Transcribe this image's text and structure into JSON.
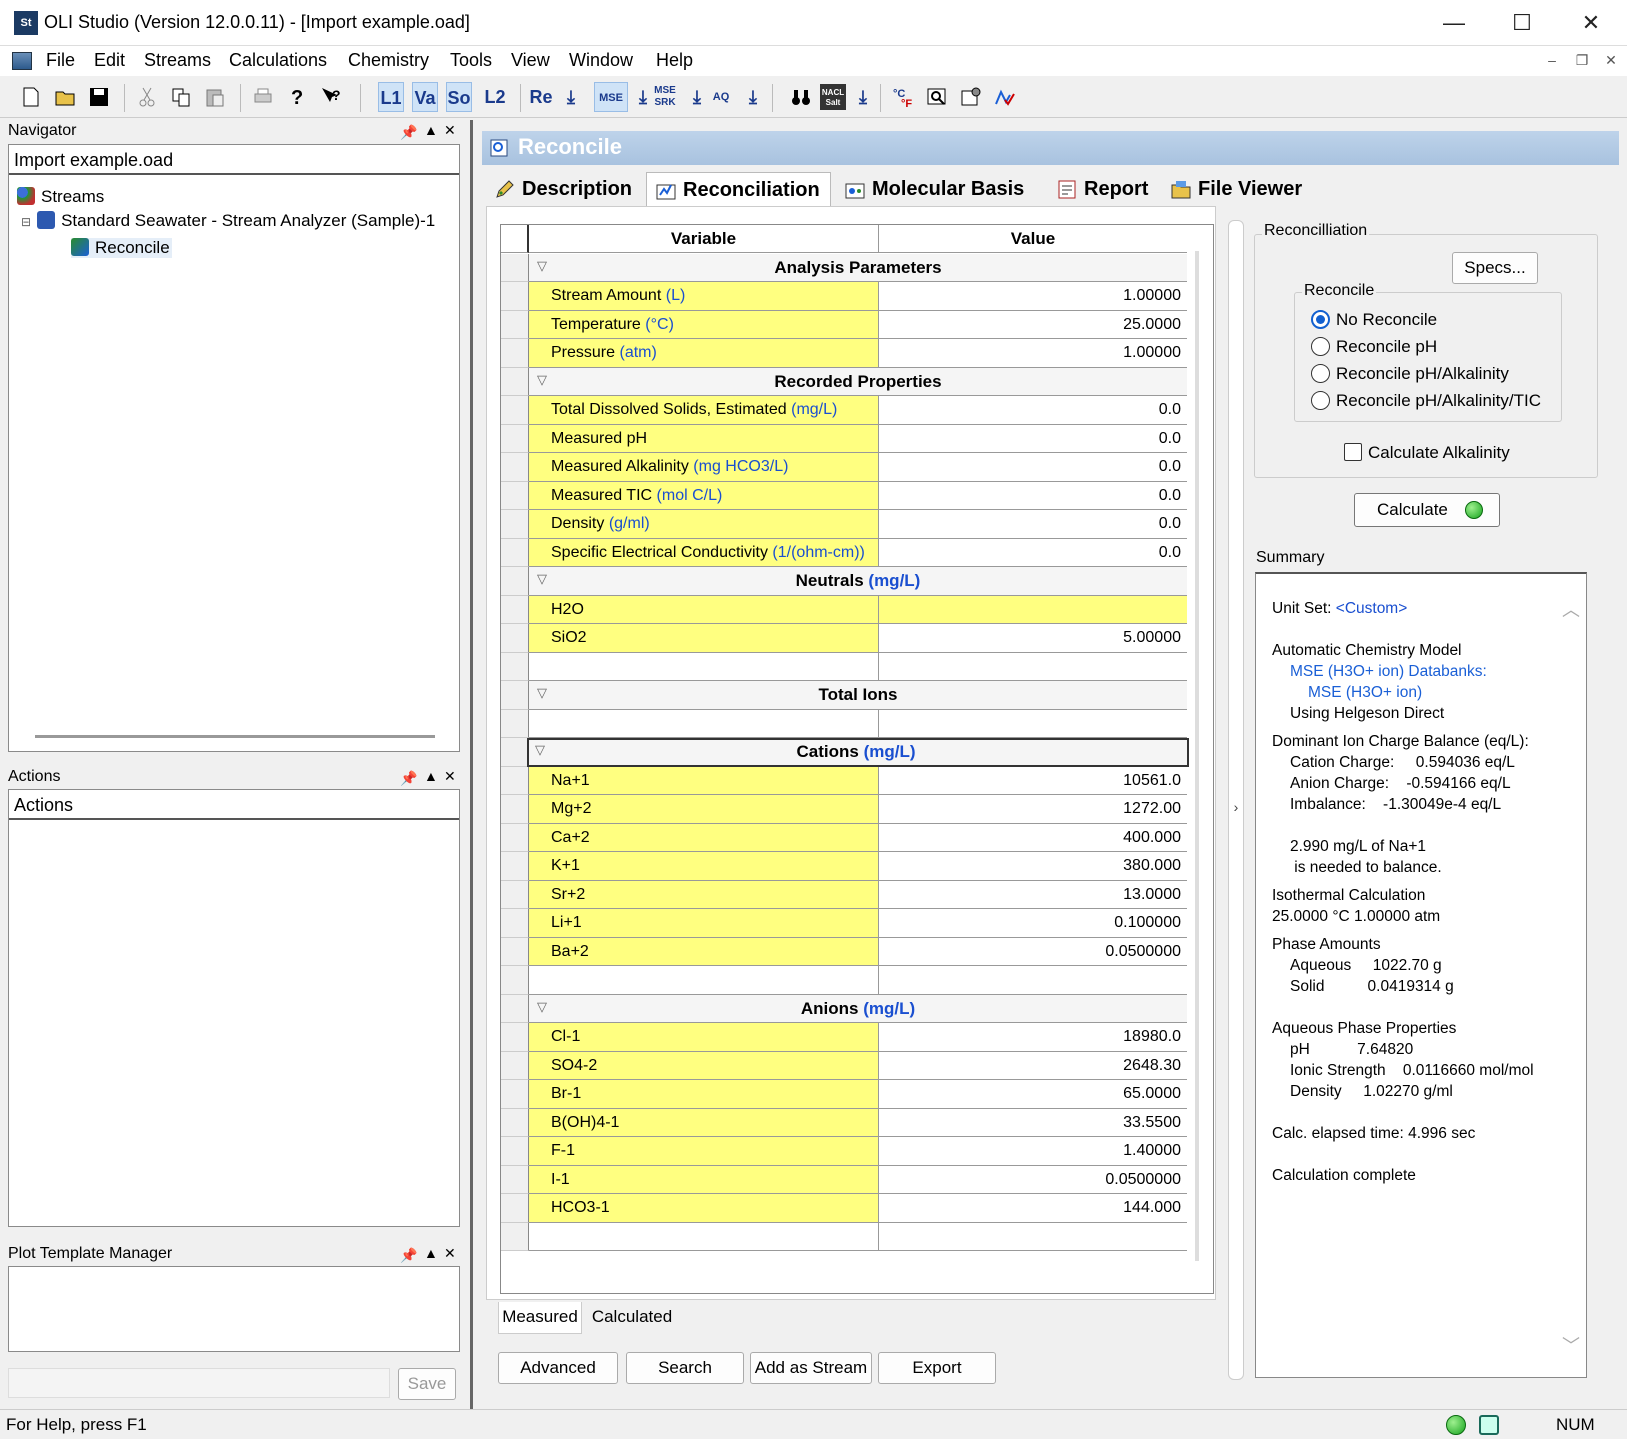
{
  "window": {
    "title": "OLI Studio (Version 12.0.0.11) - [Import example.oad]",
    "icon_text": "St",
    "minimize": "—",
    "maximize": "☐",
    "close": "✕"
  },
  "menu": [
    "File",
    "Edit",
    "Streams",
    "Calculations",
    "Chemistry",
    "Tools",
    "View",
    "Window",
    "Help"
  ],
  "toolbar": {
    "levels": [
      "L1",
      "Va",
      "So",
      "L2"
    ],
    "re": "Re",
    "mse": "MSE",
    "mse_srk": "MSE SRK",
    "aq": "AQ",
    "nacl": "NACL Salt"
  },
  "navigator": {
    "header": "Navigator",
    "file": "Import example.oad",
    "tree": {
      "streams": "Streams",
      "stream": "Standard Seawater - Stream Analyzer (Sample)-1",
      "reconcile": "Reconcile"
    }
  },
  "actions": {
    "header": "Actions",
    "title": "Actions"
  },
  "plot_template": {
    "header": "Plot Template Manager",
    "save": "Save"
  },
  "reconcile": {
    "title": "Reconcile",
    "tabs": [
      "Description",
      "Reconciliation",
      "Molecular Basis",
      "Report",
      "File Viewer"
    ]
  },
  "grid": {
    "col_variable": "Variable",
    "col_value": "Value",
    "analysis": {
      "title": "Analysis Parameters",
      "rows": [
        {
          "name": "Stream Amount",
          "unit": "(L)",
          "value": "1.00000"
        },
        {
          "name": "Temperature",
          "unit": "(°C)",
          "value": "25.0000"
        },
        {
          "name": "Pressure",
          "unit": "(atm)",
          "value": "1.00000"
        }
      ]
    },
    "recorded": {
      "title": "Recorded Properties",
      "rows": [
        {
          "name": "Total Dissolved Solids, Estimated",
          "unit": "(mg/L)",
          "value": "0.0"
        },
        {
          "name": "Measured pH",
          "unit": "",
          "value": "0.0"
        },
        {
          "name": "Measured Alkalinity",
          "unit": "(mg HCO3/L)",
          "value": "0.0"
        },
        {
          "name": "Measured TIC",
          "unit": "(mol C/L)",
          "value": "0.0"
        },
        {
          "name": "Density",
          "unit": "(g/ml)",
          "value": "0.0"
        },
        {
          "name": "Specific Electrical Conductivity",
          "unit": "(1/(ohm-cm))",
          "value": "0.0"
        }
      ]
    },
    "neutrals": {
      "title": "Neutrals",
      "unit": "(mg/L)",
      "rows": [
        {
          "name": "H2O",
          "value": ""
        },
        {
          "name": "SiO2",
          "value": "5.00000"
        }
      ]
    },
    "total_ions": {
      "title": "Total Ions"
    },
    "cations": {
      "title": "Cations",
      "unit": "(mg/L)",
      "rows": [
        {
          "name": "Na+1",
          "value": "10561.0"
        },
        {
          "name": "Mg+2",
          "value": "1272.00"
        },
        {
          "name": "Ca+2",
          "value": "400.000"
        },
        {
          "name": "K+1",
          "value": "380.000"
        },
        {
          "name": "Sr+2",
          "value": "13.0000"
        },
        {
          "name": "Li+1",
          "value": "0.100000"
        },
        {
          "name": "Ba+2",
          "value": "0.0500000"
        }
      ]
    },
    "anions": {
      "title": "Anions",
      "unit": "(mg/L)",
      "rows": [
        {
          "name": "Cl-1",
          "value": "18980.0"
        },
        {
          "name": "SO4-2",
          "value": "2648.30"
        },
        {
          "name": "Br-1",
          "value": "65.0000"
        },
        {
          "name": "B(OH)4-1",
          "value": "33.5500"
        },
        {
          "name": "F-1",
          "value": "1.40000"
        },
        {
          "name": "I-1",
          "value": "0.0500000"
        },
        {
          "name": "HCO3-1",
          "value": "144.000"
        }
      ]
    }
  },
  "bottom_tabs": [
    "Measured",
    "Calculated"
  ],
  "bottom_buttons": [
    "Advanced",
    "Search",
    "Add as Stream",
    "Export"
  ],
  "right_panel": {
    "group_title": "Reconcilliation",
    "specs": "Specs...",
    "reconcile_group": "Reconcile",
    "options": [
      "No Reconcile",
      "Reconcile pH",
      "Reconcile pH/Alkalinity",
      "Reconcile pH/Alkalinity/TIC"
    ],
    "selected_option": "No Reconcile",
    "calc_alkalinity": "Calculate Alkalinity",
    "calc_alkalinity_checked": false,
    "calculate": "Calculate",
    "summary_label": "Summary"
  },
  "summary": {
    "unit_set_label": "Unit Set:",
    "unit_set_value": "<Custom>",
    "model_label": "Automatic Chemistry Model",
    "model_link1": "MSE (H3O+ ion) Databanks:",
    "model_link2": "MSE (H3O+ ion)",
    "helgeson": "Using Helgeson Direct",
    "balance_title": "Dominant Ion Charge Balance (eq/L):",
    "cation_charge": "Cation Charge:     0.594036 eq/L",
    "anion_charge": "Anion Charge:    -0.594166 eq/L",
    "imbalance": "Imbalance:    -1.30049e-4 eq/L",
    "needed1": "2.990 mg/L of Na+1",
    "needed2": " is needed to balance.",
    "iso_title": "Isothermal Calculation",
    "iso_value": "25.0000 °C 1.00000 atm",
    "phase_title": "Phase Amounts",
    "aqueous": "Aqueous     1022.70 g",
    "solid": "Solid          0.0419314 g",
    "props_title": "Aqueous Phase Properties",
    "ph": "pH           7.64820",
    "ionic": "Ionic Strength    0.0116660 mol/mol",
    "density": "Density     1.02270 g/ml",
    "elapsed": "Calc. elapsed time: 4.996 sec",
    "complete": "Calculation complete"
  },
  "status": {
    "help": "For Help, press F1",
    "num": "NUM"
  }
}
